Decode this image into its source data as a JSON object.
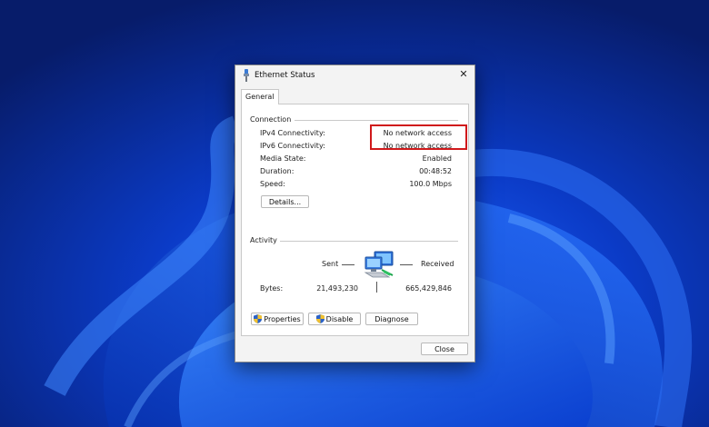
{
  "window": {
    "title": "Ethernet Status",
    "close_glyph": "✕"
  },
  "tabs": [
    {
      "label": "General"
    }
  ],
  "connection": {
    "heading": "Connection",
    "rows": [
      {
        "label": "IPv4 Connectivity:",
        "value": "No network access"
      },
      {
        "label": "IPv6 Connectivity:",
        "value": "No network access"
      },
      {
        "label": "Media State:",
        "value": "Enabled"
      },
      {
        "label": "Duration:",
        "value": "00:48:52"
      },
      {
        "label": "Speed:",
        "value": "100.0 Mbps"
      }
    ],
    "details_button": "Details..."
  },
  "activity": {
    "heading": "Activity",
    "sent_label": "Sent",
    "received_label": "Received",
    "bytes_label": "Bytes:",
    "bytes_sent": "21,493,230",
    "bytes_received": "665,429,846"
  },
  "buttons": {
    "properties": "Properties",
    "disable": "Disable",
    "diagnose": "Diagnose",
    "close": "Close"
  },
  "icons": {
    "title": "ethernet-plug-icon",
    "network": "network-computers-icon",
    "uac": "uac-shield-icon"
  },
  "colors": {
    "highlight": "#d0191b",
    "wallpaper": "#0a2a8c"
  }
}
